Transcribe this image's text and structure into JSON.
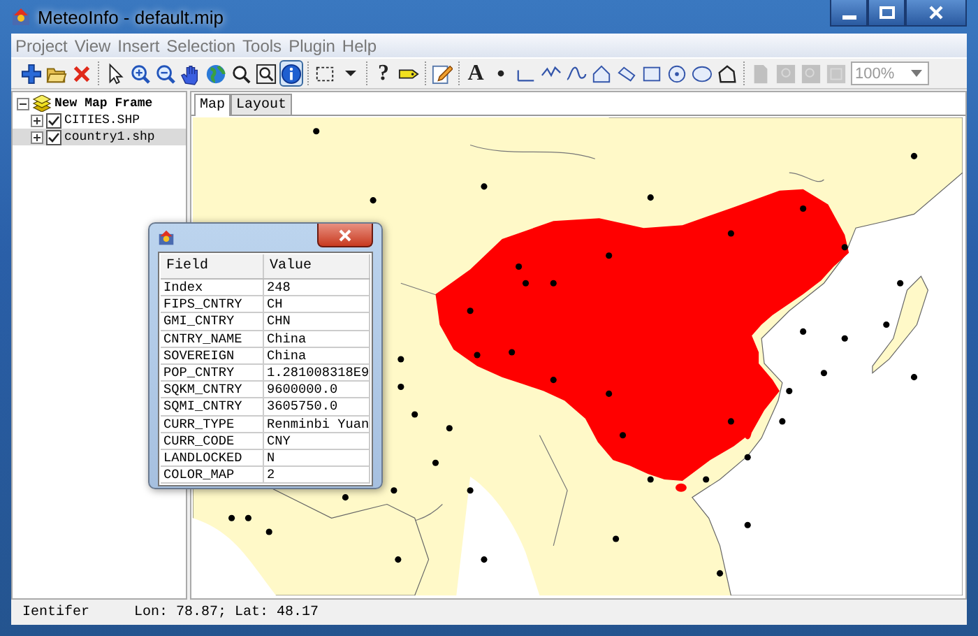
{
  "window": {
    "title": "MeteoInfo - default.mip"
  },
  "menu": [
    "Project",
    "View",
    "Insert",
    "Selection",
    "Tools",
    "Plugin",
    "Help"
  ],
  "toolbar": [
    {
      "kind": "button",
      "selected": false,
      "disabled": false
    },
    {
      "kind": "button",
      "selected": false,
      "disabled": false
    },
    {
      "kind": "button",
      "selected": false,
      "disabled": false
    },
    {
      "kind": "separator"
    },
    {
      "kind": "button",
      "selected": false,
      "disabled": false
    },
    {
      "kind": "button",
      "selected": false,
      "disabled": false
    },
    {
      "kind": "button",
      "selected": false,
      "disabled": false
    },
    {
      "kind": "button",
      "selected": false,
      "disabled": false
    },
    {
      "kind": "button",
      "selected": false,
      "disabled": false
    },
    {
      "kind": "button",
      "selected": false,
      "disabled": false
    },
    {
      "kind": "button",
      "selected": false,
      "disabled": false
    },
    {
      "kind": "button",
      "selected": true,
      "disabled": false
    },
    {
      "kind": "separator"
    },
    {
      "kind": "button",
      "selected": false,
      "disabled": false
    },
    {
      "kind": "button",
      "selected": false,
      "disabled": false
    },
    {
      "kind": "separator"
    },
    {
      "kind": "button",
      "selected": false,
      "disabled": false,
      "text": "?"
    },
    {
      "kind": "button",
      "selected": false,
      "disabled": false
    },
    {
      "kind": "separator"
    },
    {
      "kind": "button",
      "selected": false,
      "disabled": false
    },
    {
      "kind": "separator"
    },
    {
      "kind": "button",
      "selected": false,
      "disabled": false,
      "text": "A"
    },
    {
      "kind": "button",
      "selected": false,
      "disabled": false
    },
    {
      "kind": "button",
      "selected": false,
      "disabled": false
    },
    {
      "kind": "button",
      "selected": false,
      "disabled": false
    },
    {
      "kind": "button",
      "selected": false,
      "disabled": false
    },
    {
      "kind": "button",
      "selected": false,
      "disabled": false
    },
    {
      "kind": "button",
      "selected": false,
      "disabled": false
    },
    {
      "kind": "button",
      "selected": false,
      "disabled": false
    },
    {
      "kind": "button",
      "selected": false,
      "disabled": false
    },
    {
      "kind": "button",
      "selected": false,
      "disabled": false
    },
    {
      "kind": "button",
      "selected": false,
      "disabled": false
    },
    {
      "kind": "separator"
    },
    {
      "kind": "button",
      "selected": false,
      "disabled": true
    },
    {
      "kind": "button",
      "selected": false,
      "disabled": true
    },
    {
      "kind": "button",
      "selected": false,
      "disabled": true
    },
    {
      "kind": "button",
      "selected": false,
      "disabled": true
    },
    {
      "kind": "combo",
      "value": "100%"
    }
  ],
  "tree": {
    "label": "New Map Frame",
    "expanded": true,
    "children": [
      {
        "label": "CITIES.SHP",
        "checked": true,
        "selected": false,
        "expanded": false
      },
      {
        "label": "country1.shp",
        "checked": true,
        "selected": true,
        "expanded": false
      }
    ]
  },
  "tabs": [
    {
      "label": "Map",
      "selected": true
    },
    {
      "label": "Layout",
      "selected": false
    }
  ],
  "attributes": {
    "columns": [
      "Field",
      "Value"
    ],
    "rows": [
      [
        "Index",
        "248"
      ],
      [
        "FIPS_CNTRY",
        "CH"
      ],
      [
        "GMI_CNTRY",
        "CHN"
      ],
      [
        "CNTRY_NAME",
        "China"
      ],
      [
        "SOVEREIGN",
        "China"
      ],
      [
        "POP_CNTRY",
        "1.281008318E9"
      ],
      [
        "SQKM_CNTRY",
        "9600000.0"
      ],
      [
        "SQMI_CNTRY",
        "3605750.0"
      ],
      [
        "CURR_TYPE",
        "Renminbi Yuan"
      ],
      [
        "CURR_CODE",
        "CNY"
      ],
      [
        "LANDLOCKED",
        "N"
      ],
      [
        "COLOR_MAP",
        "2"
      ]
    ]
  },
  "status_bar": {
    "tool": "Ientifer",
    "coords": "Lon: 78.87; Lat: 48.17"
  }
}
